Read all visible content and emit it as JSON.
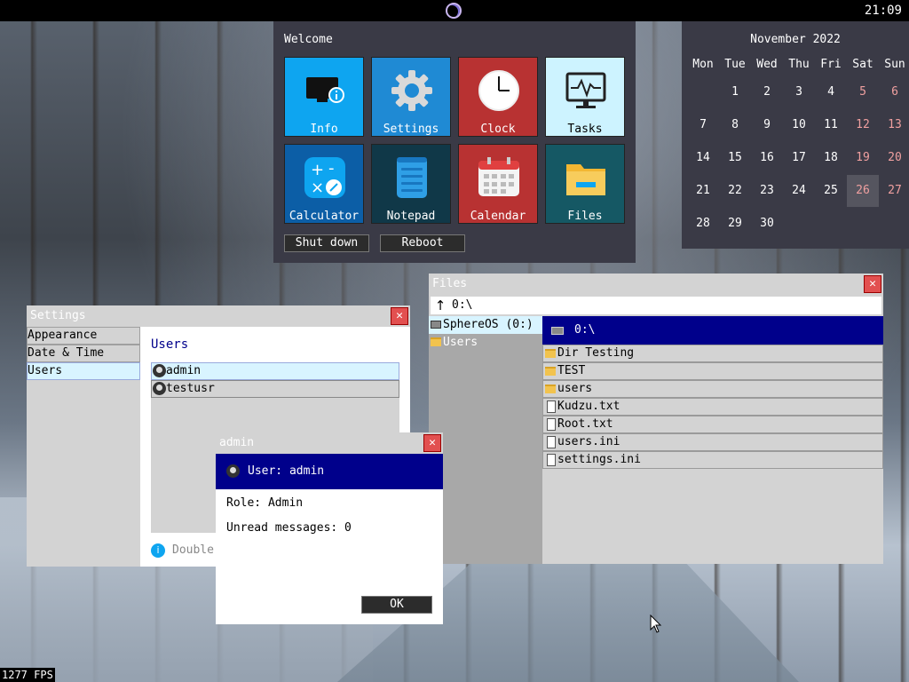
{
  "topbar": {
    "clock": "21:09"
  },
  "start_menu": {
    "welcome": "Welcome",
    "tiles": [
      {
        "label": "Info",
        "color": "#0ea5f0"
      },
      {
        "label": "Settings",
        "color": "#1f8ad4"
      },
      {
        "label": "Clock",
        "color": "#b83232"
      },
      {
        "label": "Tasks",
        "color": "#cdf3ff"
      },
      {
        "label": "Calculator",
        "color": "#0c5ea6"
      },
      {
        "label": "Notepad",
        "color": "#103848"
      },
      {
        "label": "Calendar",
        "color": "#b83232"
      },
      {
        "label": "Files",
        "color": "#155864"
      }
    ],
    "shutdown_label": "Shut down",
    "reboot_label": "Reboot"
  },
  "calendar": {
    "title": "November 2022",
    "day_headers": [
      "Mon",
      "Tue",
      "Wed",
      "Thu",
      "Fri",
      "Sat",
      "Sun"
    ],
    "weeks": [
      [
        "",
        "1",
        "2",
        "3",
        "4",
        "5",
        "6"
      ],
      [
        "7",
        "8",
        "9",
        "10",
        "11",
        "12",
        "13"
      ],
      [
        "14",
        "15",
        "16",
        "17",
        "18",
        "19",
        "20"
      ],
      [
        "21",
        "22",
        "23",
        "24",
        "25",
        "26",
        "27"
      ],
      [
        "28",
        "29",
        "30",
        "",
        "",
        "",
        ""
      ]
    ],
    "today": "26"
  },
  "settings_window": {
    "title": "Settings",
    "sidebar_items": [
      "Appearance",
      "Date & Time",
      "Users"
    ],
    "active_section": "Users",
    "section_heading": "Users",
    "users": [
      "admin",
      "testusr"
    ],
    "hint": "Double"
  },
  "files_window": {
    "title": "Files",
    "path": "0:\\",
    "drives": [
      "SphereOS (0:)",
      "Users"
    ],
    "current_dir": "0:\\",
    "entries": [
      {
        "name": "Dir Testing",
        "type": "folder"
      },
      {
        "name": "TEST",
        "type": "folder"
      },
      {
        "name": "users",
        "type": "folder"
      },
      {
        "name": "Kudzu.txt",
        "type": "file"
      },
      {
        "name": "Root.txt",
        "type": "file"
      },
      {
        "name": "users.ini",
        "type": "file"
      },
      {
        "name": "settings.ini",
        "type": "file"
      }
    ]
  },
  "admin_dialog": {
    "title": "admin",
    "header": "User: admin",
    "role": "Role: Admin",
    "unread": "Unread messages: 0",
    "ok_label": "OK"
  },
  "fps": "1277 FPS"
}
